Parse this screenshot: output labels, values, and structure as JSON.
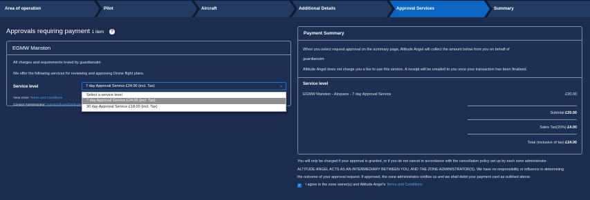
{
  "stepper": {
    "steps": [
      {
        "label": "Area of operation"
      },
      {
        "label": "Pilot"
      },
      {
        "label": "Aircraft"
      },
      {
        "label": "Additional Details"
      },
      {
        "label": "Approval Services"
      },
      {
        "label": "Summary"
      }
    ],
    "active_index": 4
  },
  "page": {
    "title": "Approvals requiring payment",
    "count": "1 item"
  },
  "zone": {
    "name": "EGMW Manston",
    "charges_line": "All charges and requirements levied by guardianutm",
    "services_line": "We offer the following services for reviewing and approving Drone flight plans.",
    "service_level_label": "Service level",
    "view_zone_label": "View zone:",
    "terms_link": "Terms and Conditions",
    "contact_label": "Contact Administrator:",
    "contact_email": "manstonflows@altitudeangel.com"
  },
  "service_select": {
    "value": "7 day Approval Service £24.00 (incl. Tax)",
    "options": [
      "Select a service level",
      "7 day Approval Service £24.00 (incl. Tax)",
      "30 day Approval Service £18.00 (incl. Tax)"
    ],
    "highlighted_index": 1
  },
  "payment": {
    "title": "Payment Summary",
    "intro": "When you select request approval on the summary page, Altitude Angel will collect the amount below from you on behalf of",
    "payee": "guardianutm",
    "fee_note": "Altitude Angel does not charge you a fee to use this service. A receipt will be emailed to you once your transaction has been finalised.",
    "service_level_label": "Service level",
    "line_item": "EGMW Manston - Airspace - 7 day Approval Service",
    "line_amount": "£20.00",
    "subtotal_label": "Subtotal",
    "subtotal": "£20.00",
    "tax_label": "Sales Tax(20%)",
    "tax": "£4.00",
    "total_label": "Total (inclusive of tax)",
    "total": "£24.00"
  },
  "footer": {
    "charge_note": "You will only be charged if your approval is granted, or if you do not cancel in accordance with the cancellation policy set up by each zone administrator.",
    "disclaimer_1": "ALTITUDE ANGEL ACTS AS AN INTERMEDIARY BETWEEN YOU, AND THE ZONE ADMINISTRATOR(S). We have no responsibility or influence in determining",
    "disclaimer_2": "the outcome of your approval request. If approved, the zone administrator notifies us and we shall debit your payment card as outlined above.",
    "agree_prefix": "I agree to the zone owner(s) and Altitude Angel's",
    "agree_link": "Terms and Conditions",
    "agree_checked": true
  }
}
